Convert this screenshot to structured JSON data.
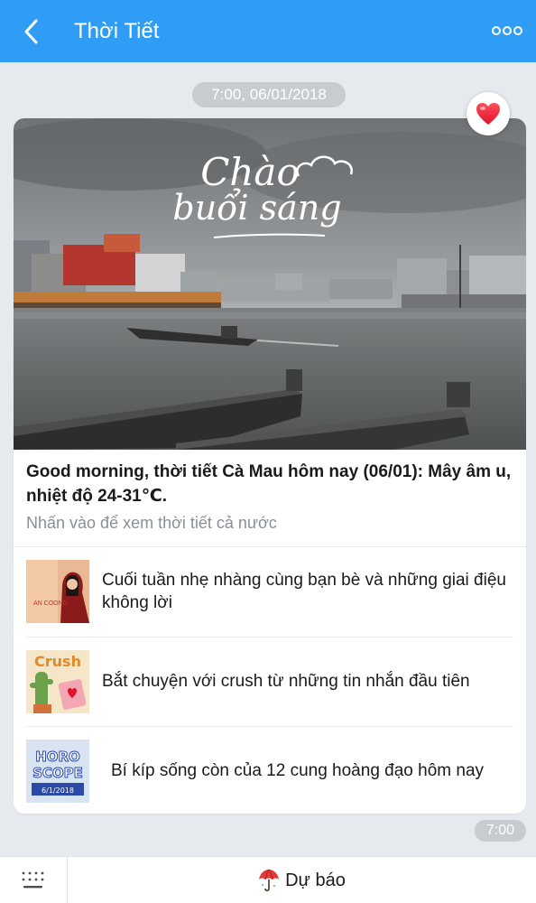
{
  "header": {
    "title": "Thời Tiết",
    "background_color": "#2f9df5",
    "back_icon": "chevron-left-icon",
    "more_icon": "more-dots-icon"
  },
  "message": {
    "date_stamp": "7:00, 06/01/2018",
    "time_stamp": "7:00"
  },
  "card": {
    "hero": {
      "overlay_text_line1": "Chào",
      "overlay_text_line2": "buổi sáng",
      "reaction_icon": "heart-icon"
    },
    "headline": "Good morning, thời tiết Cà Mau hôm nay (06/01): Mây âm u, nhiệt độ 24-31℃.",
    "subline": "Nhấn vào để xem thời tiết cả nước",
    "articles": [
      {
        "title": "Cuối tuần nhẹ nhàng cùng bạn bè và những giai điệu không lời",
        "thumb_text": "AN COONG"
      },
      {
        "title": "Bắt chuyện với crush từ những tin nhắn đầu tiên",
        "thumb_text": "Crush"
      },
      {
        "title": "Bí kíp sống còn của 12 cung hoàng đạo hôm nay",
        "thumb_text_line1": "HORO",
        "thumb_text_line2": "SCOPE",
        "thumb_text_line3": "6/1/2018"
      }
    ]
  },
  "bottom_bar": {
    "keyboard_icon": "keyboard-icon",
    "forecast_icon": "umbrella-icon",
    "forecast_label": "Dự báo"
  }
}
